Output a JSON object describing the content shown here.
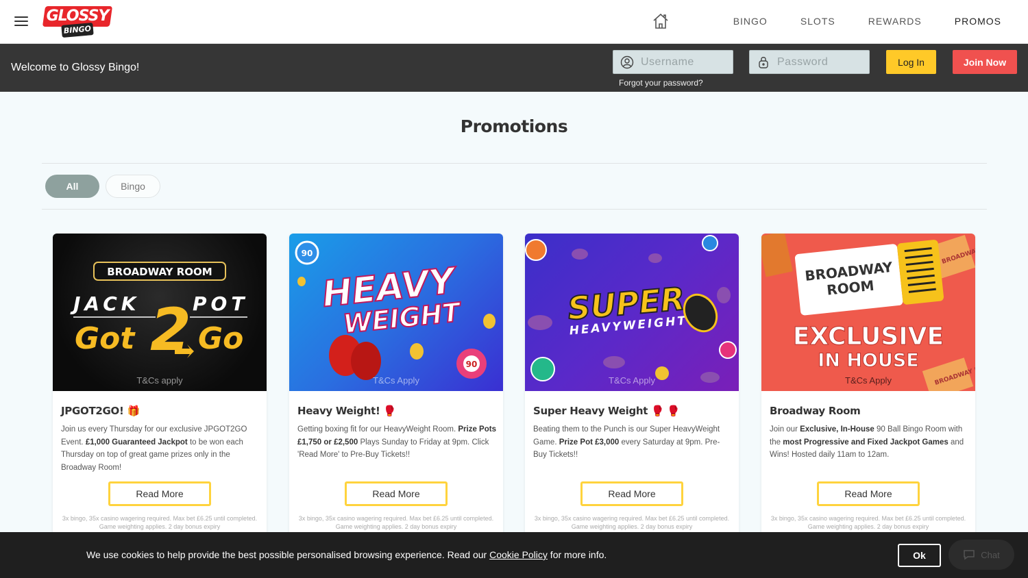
{
  "header": {
    "logo_text": "GLOSSY",
    "logo_sub": "BINGO",
    "nav": [
      {
        "label": "BINGO"
      },
      {
        "label": "SLOTS"
      },
      {
        "label": "REWARDS"
      },
      {
        "label": "PROMOS"
      }
    ]
  },
  "loginbar": {
    "welcome": "Welcome to Glossy Bingo!",
    "username_placeholder": "Username",
    "password_placeholder": "Password",
    "forgot": "Forgot your password?",
    "login_label": "Log In",
    "join_label": "Join Now"
  },
  "main": {
    "title": "Promotions",
    "filters": [
      "All",
      "Bingo"
    ]
  },
  "cards": [
    {
      "banner_top": "BROADWAY ROOM",
      "banner_line1": "JACK",
      "banner_line1b": "POT",
      "banner_line2a": "Got",
      "banner_num": "2",
      "banner_line2b": "Go",
      "banner_tcs": "T&Cs apply",
      "title": "JPGOT2GO!",
      "title_emoji": "🎁",
      "desc_html": [
        "Join us every Thursday for our exclusive JPGOT2GO Event. ",
        "£1,000 Guaranteed Jackpot",
        " to be won each Thursday on top of great game prizes only in the Broadway Room!"
      ],
      "button": "Read More",
      "small": "3x bingo, 35x casino wagering required. Max bet £6.25 until completed. Game weighting applies. 2 day bonus expiry"
    },
    {
      "banner_line1": "HEAVY",
      "banner_line2": "WEIGHT",
      "banner_tcs": "T&Cs Apply",
      "ball1": "90",
      "ball2": "90",
      "title": "Heavy Weight!",
      "title_emoji": "🥊",
      "desc_html": [
        "Getting boxing fit for our HeavyWeight Room. ",
        "Prize Pots £1,750 or £2,500",
        " Plays Sunday to Friday at 9pm. Click 'Read More' to Pre-Buy Tickets!!"
      ],
      "button": "Read More",
      "small": "3x bingo, 35x casino wagering required. Max bet £6.25 until completed. Game weighting applies. 2 day bonus expiry"
    },
    {
      "banner_line1": "SUPER",
      "banner_line2": "HEAVYWEIGHT",
      "banner_tcs": "T&Cs Apply",
      "title": "Super Heavy Weight",
      "title_emoji": "🥊 🥊",
      "desc_html": [
        "Beating them to the Punch is our Super HeavyWeight Game. ",
        "Prize Pot £3,000",
        " every Saturday at 9pm. Pre-Buy Tickets!!"
      ],
      "button": "Read More",
      "small": "3x bingo, 35x casino wagering required. Max bet £6.25 until completed. Game weighting applies. 2 day bonus expiry"
    },
    {
      "ticket_line1": "BROADWAY",
      "ticket_line2": "ROOM",
      "banner_line1": "EXCLUSIVE",
      "banner_line2": "IN HOUSE",
      "stub_text": "BROADWAY ROOM",
      "banner_tcs": "T&Cs Apply",
      "title": "Broadway Room",
      "title_emoji": "",
      "desc_html": [
        "Join our ",
        "Exclusive, In-House",
        " 90 Ball Bingo Room with the ",
        "most Progressive and Fixed Jackpot Games",
        " and Wins! Hosted daily 11am to 12am."
      ],
      "button": "Read More",
      "small": "3x bingo, 35x casino wagering required. Max bet £6.25 until completed. Game weighting applies. 2 day bonus expiry"
    }
  ],
  "cookie": {
    "text_before": "We use cookies to help provide the best possible personalised browsing experience. Read our ",
    "link": "Cookie Policy",
    "text_after": " for more info.",
    "ok_label": "Ok",
    "chat_label": "Chat"
  },
  "colors": {
    "brand_red": "#e8262b",
    "login_yellow": "#ffc928",
    "join_red": "#f0514f",
    "filter_active": "#8ea19e",
    "read_more_border": "#ffd33d"
  }
}
